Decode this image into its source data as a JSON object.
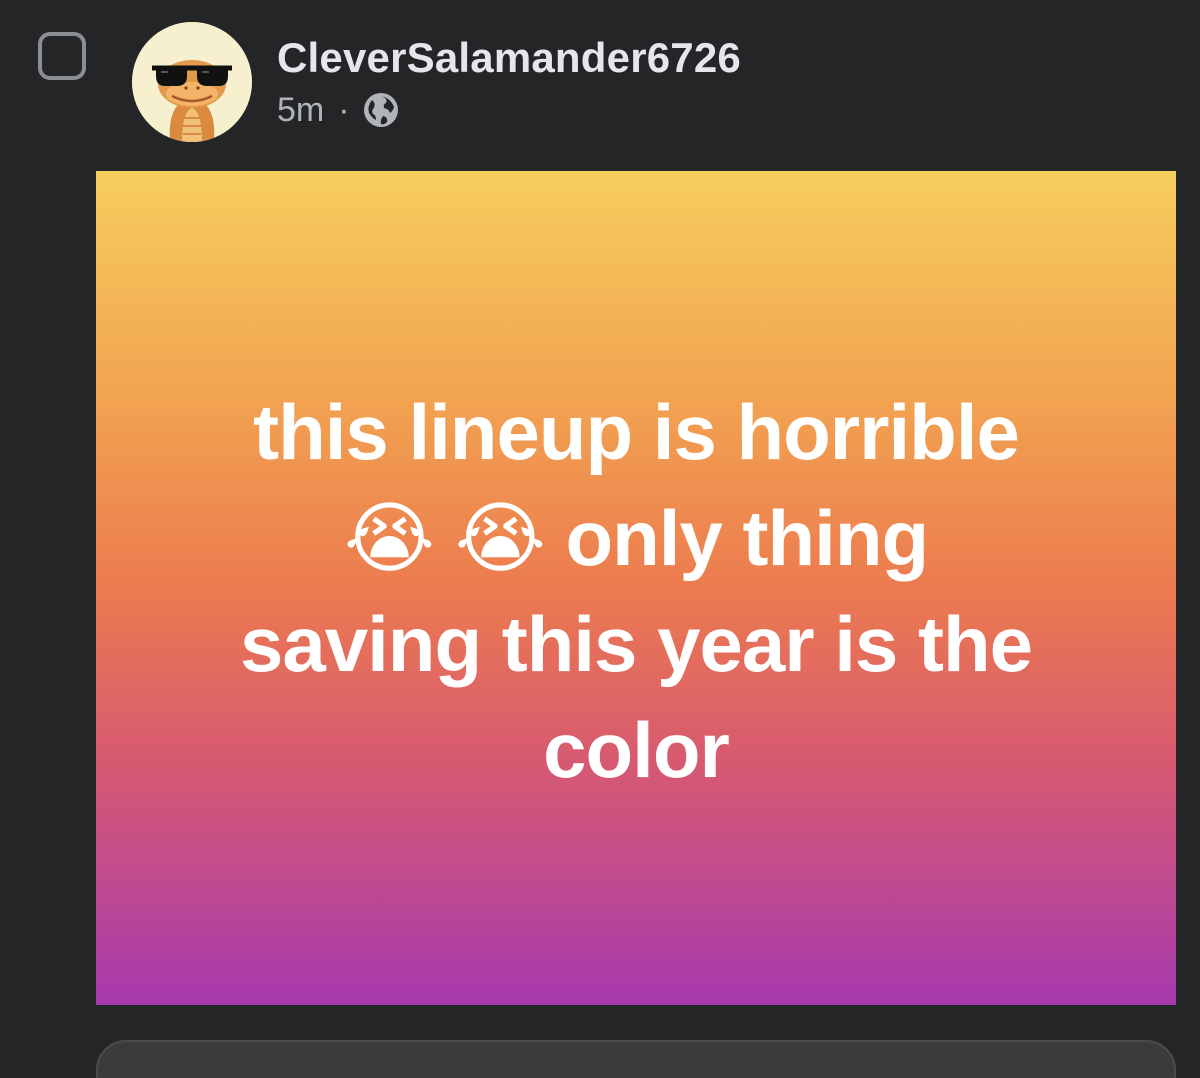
{
  "post": {
    "author": "CleverSalamander6726",
    "time": "5m",
    "separator": "·",
    "audience_icon": "globe-icon",
    "text": "this lineup is horrible 😭 😭 only thing saving this year is the color",
    "background_gradient": [
      "#f6cd5c",
      "#ec7b4f",
      "#a638ad"
    ]
  },
  "avatar": {
    "icon": "salamander-with-sunglasses-avatar"
  },
  "colors": {
    "page_background": "#242527",
    "text_primary": "#e4e6eb",
    "text_secondary": "#b0b3b8"
  }
}
